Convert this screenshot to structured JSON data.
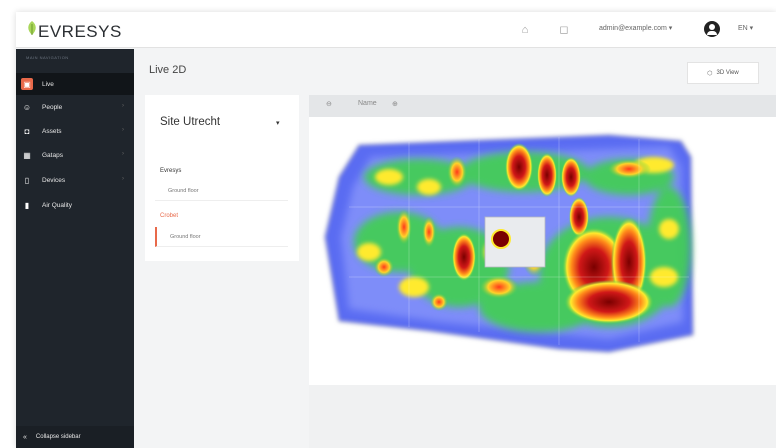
{
  "app": {
    "brand": "EVRESYS"
  },
  "header": {
    "user_email": "admin@example.com ▾",
    "language": "EN ▾",
    "icons": [
      "home-icon",
      "bell-icon",
      "user-avatar-icon"
    ]
  },
  "sidebar": {
    "section_title": "MAIN NAVIGATION",
    "items": [
      {
        "label": "Live",
        "icon": "live-icon",
        "active": true
      },
      {
        "label": "People",
        "icon": "people-icon"
      },
      {
        "label": "Assets",
        "icon": "assets-icon"
      },
      {
        "label": "Gataps",
        "icon": "gateway-icon"
      },
      {
        "label": "Devices",
        "icon": "device-icon"
      },
      {
        "label": "Air Quality",
        "icon": "thermometer-icon"
      }
    ],
    "collapse_label": "Collapse sidebar"
  },
  "main": {
    "title": "Live 2D",
    "view3d_label": "3D View"
  },
  "site_panel": {
    "site_name": "Site Utrecht",
    "groups": [
      {
        "name": "Evresys",
        "color": "#333333",
        "floors": [
          {
            "label": "Ground floor",
            "active": false
          }
        ]
      },
      {
        "name": "Crobet",
        "color": "#e8694a",
        "floors": [
          {
            "label": "Ground floor",
            "active": true
          }
        ]
      }
    ]
  },
  "map_toolbar": {
    "zoom_out": "⊖",
    "name": "Name",
    "zoom_in": "⊕"
  },
  "colors": {
    "accent": "#e8694a",
    "sidebar_bg": "#1f252c",
    "heat_low": "#3a5bff",
    "heat_mid": "#3fd04f",
    "heat_high": "#ffea2e",
    "heat_peak": "#9a0a0a"
  }
}
